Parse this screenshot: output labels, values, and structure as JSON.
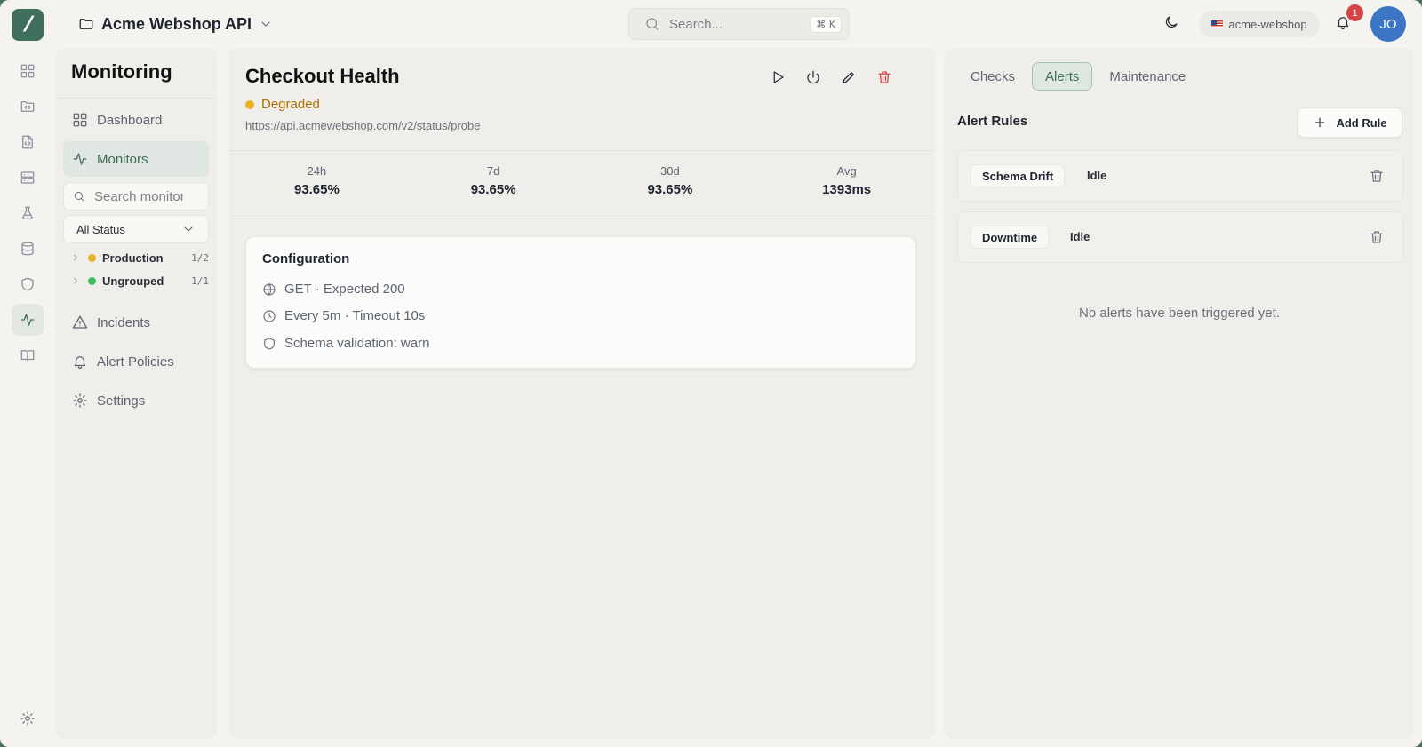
{
  "app": {
    "project_name": "Acme Webshop API",
    "search_placeholder": "Search...",
    "search_shortcut": "⌘ K",
    "workspace": "acme-webshop",
    "notification_count": "1",
    "user_initials": "JO",
    "accent_color": "#3f6e5c"
  },
  "rail": {
    "icons": [
      "dashboard-icon",
      "folder-code-icon",
      "file-code-icon",
      "server-icon",
      "flask-icon",
      "database-icon",
      "shield-icon",
      "activity-icon",
      "book-icon",
      "settings-icon"
    ],
    "active": "activity-icon"
  },
  "sidebar": {
    "heading": "Monitoring",
    "nav": {
      "dashboard": "Dashboard",
      "monitors": "Monitors",
      "incidents": "Incidents",
      "alert_policies": "Alert Policies",
      "settings": "Settings"
    },
    "search_placeholder": "Search monitors",
    "status_filter": "All Status",
    "groups": [
      {
        "name": "Production",
        "count": "1/2",
        "color": "#e8b120"
      },
      {
        "name": "Ungrouped",
        "count": "1/1",
        "color": "#3cbf5a"
      }
    ]
  },
  "monitor": {
    "title": "Checkout Health",
    "status": "Degraded",
    "status_color": "#e8b120",
    "url": "https://api.acmewebshop.com/v2/status/probe",
    "stats": [
      {
        "label": "24h",
        "value": "93.65%"
      },
      {
        "label": "7d",
        "value": "93.65%"
      },
      {
        "label": "30d",
        "value": "93.65%"
      },
      {
        "label": "Avg",
        "value": "1393ms"
      }
    ],
    "config": {
      "title": "Configuration",
      "request": "GET · Expected 200",
      "schedule": "Every 5m · Timeout 10s",
      "schema": "Schema validation: warn"
    }
  },
  "alerts_panel": {
    "tabs": [
      "Checks",
      "Alerts",
      "Maintenance"
    ],
    "active_tab": "Alerts",
    "rules_title": "Alert Rules",
    "add_rule_label": "Add Rule",
    "rules": [
      {
        "name": "Schema Drift",
        "state": "Idle"
      },
      {
        "name": "Downtime",
        "state": "Idle"
      }
    ],
    "empty_message": "No alerts have been triggered yet."
  }
}
